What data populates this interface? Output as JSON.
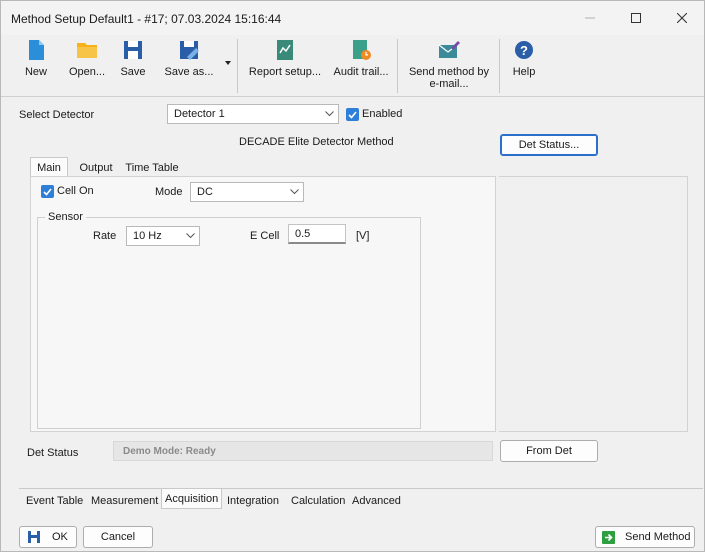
{
  "window": {
    "title": "Method Setup Default1 - #17;  07.03.2024  15:16:44"
  },
  "toolbar": {
    "items": [
      {
        "label": "New",
        "icon": "new-document-icon",
        "color": "#2a8fd8"
      },
      {
        "label": "Open...",
        "icon": "folder-icon",
        "color": "#f5b21b"
      },
      {
        "label": "Save",
        "icon": "floppy-disk-icon",
        "color": "#2a5fa8"
      },
      {
        "label": "Save as...",
        "icon": "save-as-icon",
        "color": "#2a5fa8"
      },
      {
        "label": "Report setup...",
        "icon": "report-icon",
        "color": "#3a8a7a"
      },
      {
        "label": "Audit trail...",
        "icon": "audit-trail-icon",
        "color": "#3aa08a"
      },
      {
        "label": "Send method by",
        "label2": "e-mail...",
        "icon": "email-icon",
        "color": "#3a8a9a"
      },
      {
        "label": "Help",
        "icon": "help-icon",
        "color": "#2a5fa8"
      }
    ]
  },
  "detector": {
    "select_label": "Select Detector",
    "selected": "Detector 1",
    "enabled_label": "Enabled",
    "enabled": true
  },
  "method": {
    "title": "DECADE Elite Detector Method",
    "det_status_button": "Det Status...",
    "tabs": [
      "Main",
      "Output",
      "Time Table"
    ],
    "active_tab": "Main",
    "cell_on_label": "Cell On",
    "cell_on": true,
    "mode_label": "Mode",
    "mode_value": "DC",
    "sensor_group": "Sensor",
    "rate_label": "Rate",
    "rate_value": "10 Hz",
    "ecell_label": "E Cell",
    "ecell_value": "0.5",
    "ecell_unit": "[V]"
  },
  "status": {
    "label": "Det Status",
    "value": "Demo Mode: Ready",
    "from_det_button": "From Det"
  },
  "bottom_tabs": [
    "Event Table",
    "Measurement",
    "Acquisition",
    "Integration",
    "Calculation",
    "Advanced"
  ],
  "active_bottom_tab": "Acquisition",
  "footer": {
    "ok_label": "OK",
    "cancel_label": "Cancel",
    "send_method_label": "Send Method",
    "accent": "#2e9e3e"
  }
}
